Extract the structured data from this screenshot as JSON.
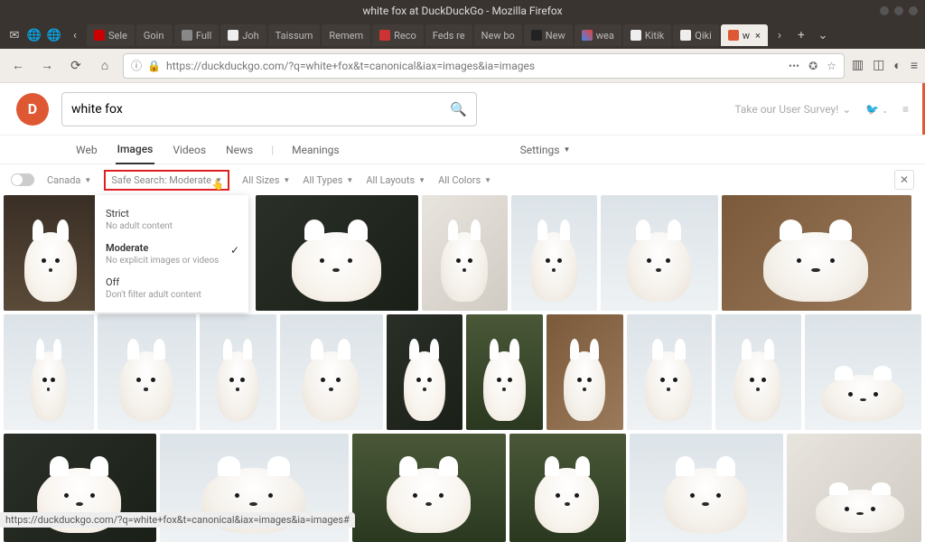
{
  "window": {
    "title": "white fox at DuckDuckGo - Mozilla Firefox"
  },
  "tabs": {
    "items": [
      "Sele",
      "Goin",
      "Full",
      "Joh",
      "Taissum",
      "Remem",
      "Reco",
      "Feds re",
      "New bo",
      "New",
      "wea",
      "Kitik",
      "Qiki"
    ],
    "active": "w",
    "activeClose": "×"
  },
  "url": "https://duckduckgo.com/?q=white+fox&t=canonical&iax=images&ia=images",
  "search": {
    "query": "white fox"
  },
  "headerRight": {
    "survey": "Take our User Survey!"
  },
  "cats": {
    "web": "Web",
    "images": "Images",
    "videos": "Videos",
    "news": "News",
    "meanings": "Meanings",
    "settings": "Settings"
  },
  "filters": {
    "region": "Canada",
    "safesearch": "Safe Search: Moderate",
    "sizes": "All Sizes",
    "types": "All Types",
    "layouts": "All Layouts",
    "colors": "All Colors"
  },
  "ssmenu": {
    "strict": {
      "t": "Strict",
      "d": "No adult content"
    },
    "moderate": {
      "t": "Moderate",
      "d": "No explicit images or videos"
    },
    "off": {
      "t": "Off",
      "d": "Don't filter adult content"
    }
  },
  "status": "https://duckduckgo.com/?q=white+fox&t=canonical&iax=images&ia=images#"
}
